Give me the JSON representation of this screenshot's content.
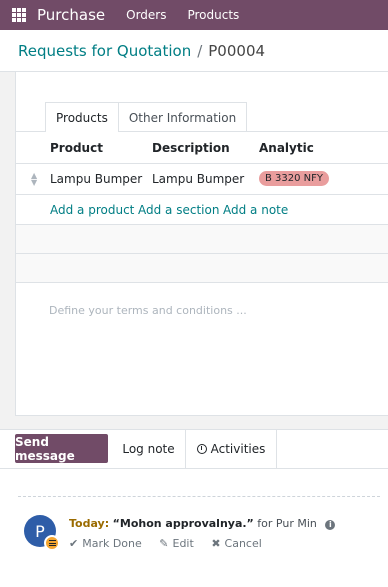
{
  "topbar": {
    "app_name": "Purchase",
    "menu": [
      "Orders",
      "Products"
    ],
    "background": "#714B67",
    "apps_icon": "grid-icon"
  },
  "breadcrumb": {
    "parent": "Requests for Quotation",
    "separator": "/",
    "current": "P00004"
  },
  "tabs": [
    {
      "label": "Products",
      "active": true
    },
    {
      "label": "Other Information",
      "active": false
    }
  ],
  "lines": {
    "headers": [
      "Product",
      "Description",
      "Analytic"
    ],
    "rows": [
      {
        "product": "Lampu Bumper",
        "description": "Lampu Bumper",
        "analytic": "B 3320 NFY"
      }
    ],
    "add_product": "Add a product",
    "add_section": "Add a section",
    "add_note": "Add a note"
  },
  "terms": {
    "placeholder": "Define your terms and conditions ..."
  },
  "chatter": {
    "send_message": "Send message",
    "log_note": "Log note",
    "activities": "Activities",
    "activity": {
      "avatar_initial": "P",
      "when": "Today:",
      "summary": "“Mohon approvalnya.”",
      "for_text": "for Pur Min",
      "mark_done": "Mark Done",
      "edit": "Edit",
      "cancel": "Cancel"
    }
  },
  "colors": {
    "brand": "#714B67",
    "link": "#017e84",
    "badge": "#e99d9d",
    "avatar": "#2e5da8",
    "activity_today": "#9a6b00"
  }
}
